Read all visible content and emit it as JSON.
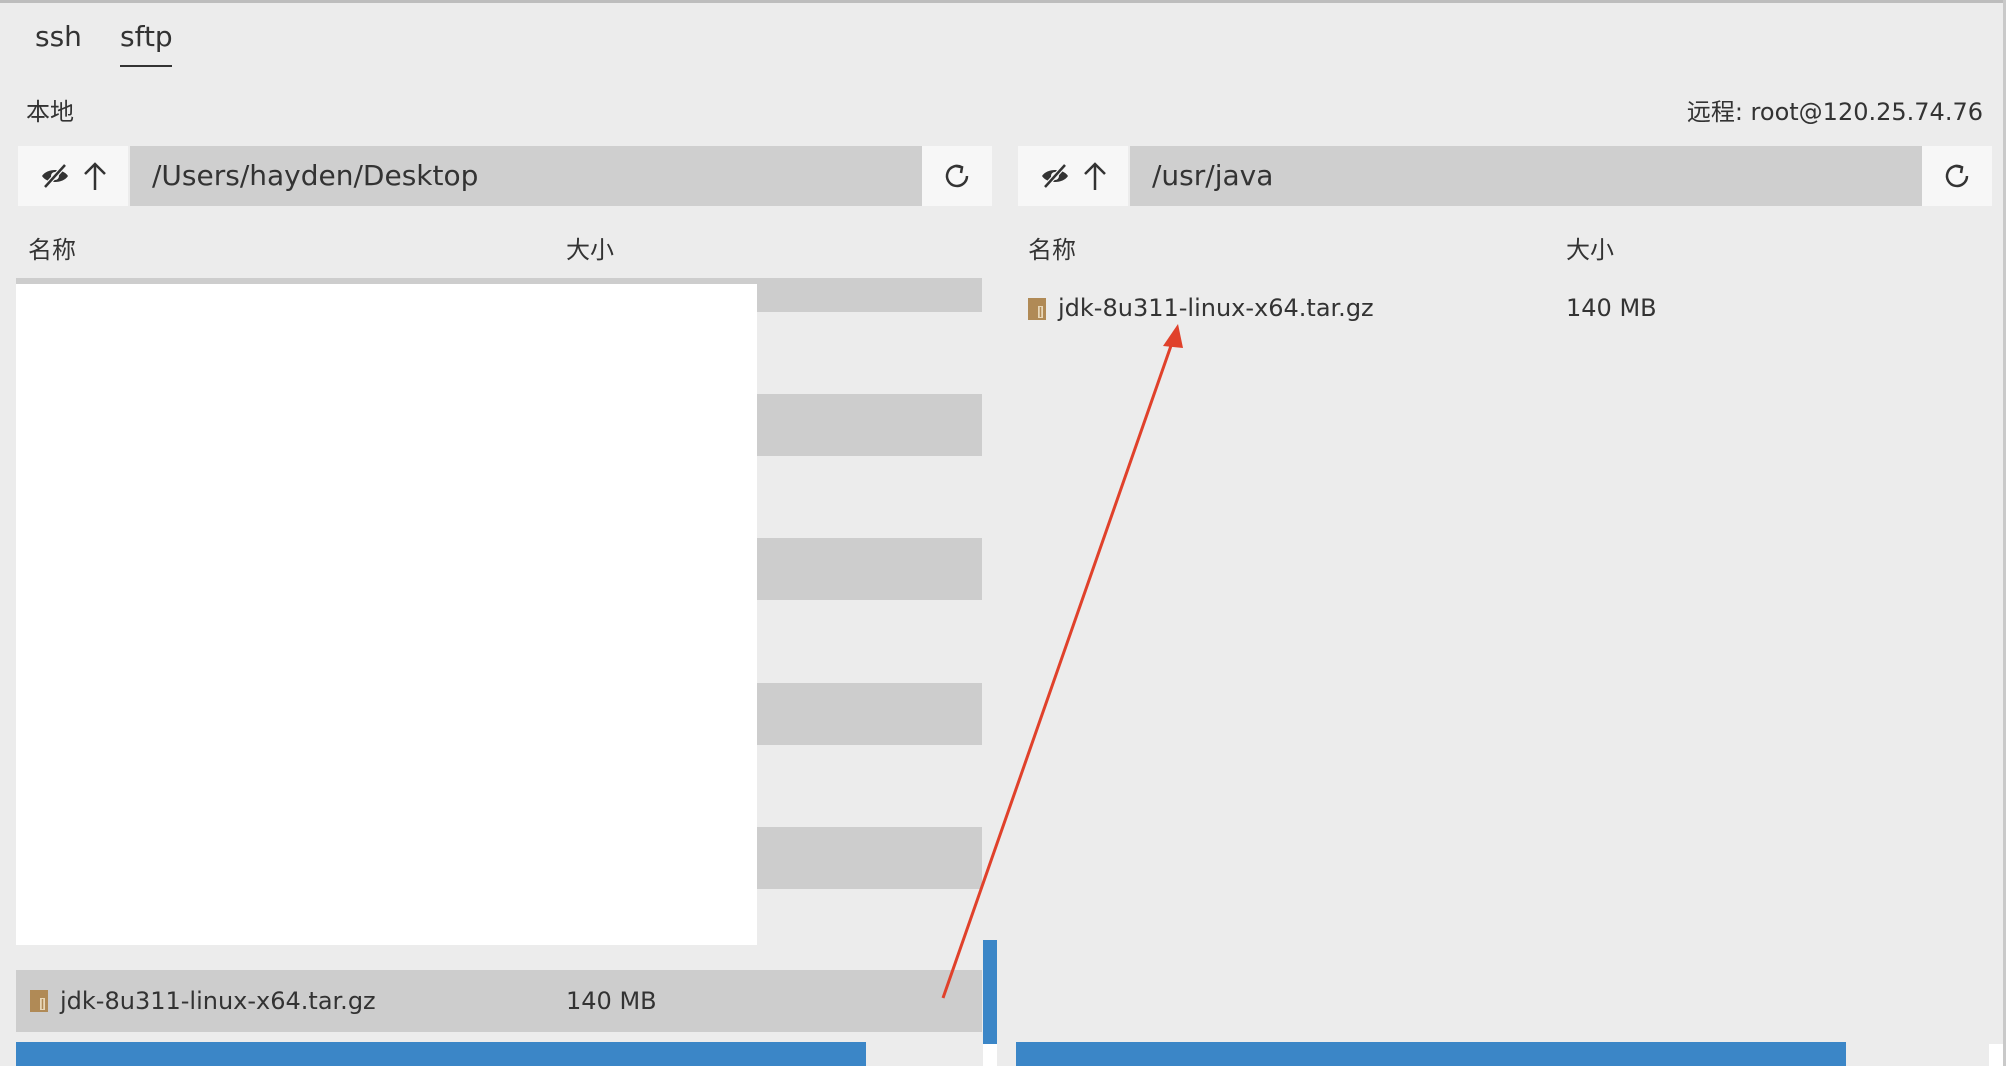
{
  "tabs": [
    {
      "label": "ssh"
    },
    {
      "label": "sftp",
      "active": true
    }
  ],
  "local": {
    "label": "本地",
    "path": "/Users/hayden/Desktop",
    "columns": {
      "name": "名称",
      "size": "大小"
    },
    "file": {
      "name": "jdk-8u311-linux-x64.tar.gz",
      "size": "140 MB",
      "icon": "archive-icon"
    }
  },
  "remote": {
    "label": "远程: root@120.25.74.76",
    "path": "/usr/java",
    "columns": {
      "name": "名称",
      "size": "大小"
    },
    "file": {
      "name": "jdk-8u311-linux-x64.tar.gz",
      "size": "140 MB",
      "icon": "archive-icon"
    }
  },
  "colors": {
    "accent": "#3b86c7",
    "arrow": "#e0412b",
    "archive": "#b08a56"
  }
}
